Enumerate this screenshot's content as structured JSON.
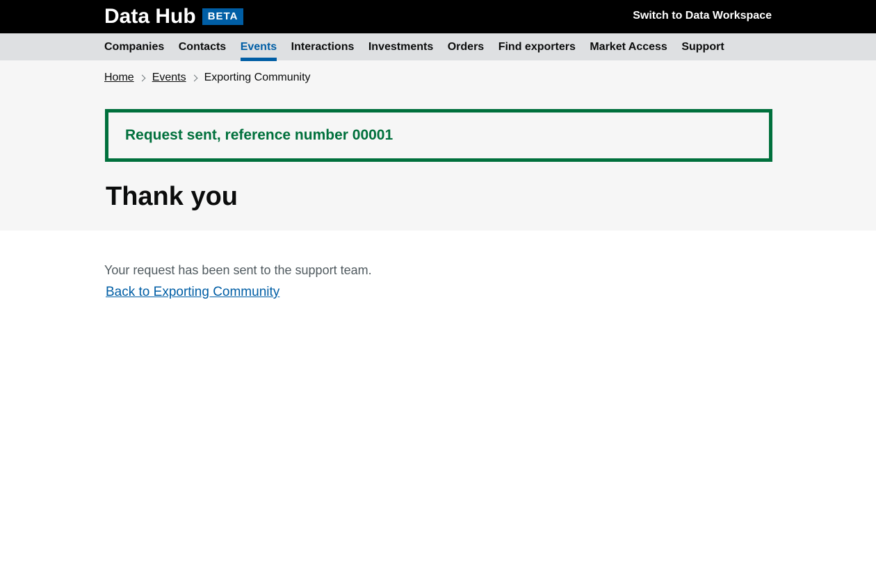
{
  "header": {
    "app_name": "Data Hub",
    "beta_label": "BETA",
    "switch_link": "Switch to Data Workspace"
  },
  "nav": {
    "items": [
      {
        "label": "Companies",
        "active": false
      },
      {
        "label": "Contacts",
        "active": false
      },
      {
        "label": "Events",
        "active": true
      },
      {
        "label": "Interactions",
        "active": false
      },
      {
        "label": "Investments",
        "active": false
      },
      {
        "label": "Orders",
        "active": false
      },
      {
        "label": "Find exporters",
        "active": false
      },
      {
        "label": "Market Access",
        "active": false
      },
      {
        "label": "Support",
        "active": false
      }
    ]
  },
  "breadcrumb": {
    "home": "Home",
    "events": "Events",
    "current": "Exporting Community"
  },
  "notification": {
    "message": "Request sent, reference number 00001"
  },
  "page": {
    "title": "Thank you",
    "body": "Your request has been sent to the support team.",
    "back_link": "Back to Exporting Community"
  },
  "colors": {
    "header_bg": "#000000",
    "nav_bg": "#dee0e2",
    "accent_blue": "#005ea5",
    "success_green": "#00703c",
    "band_bg": "#f6f6f6"
  }
}
